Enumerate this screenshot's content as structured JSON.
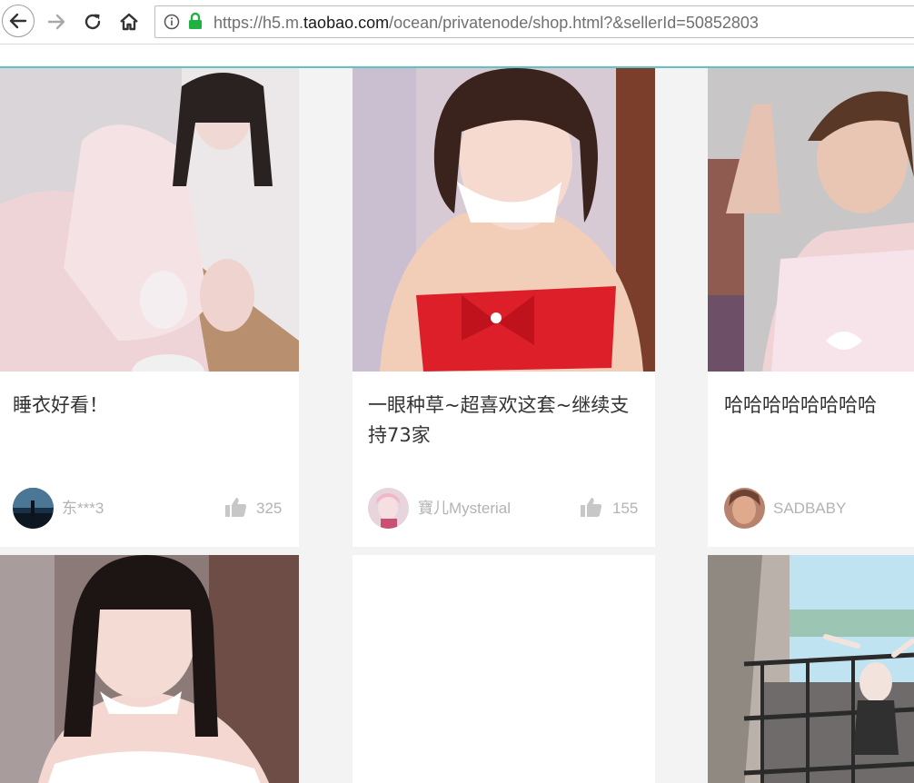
{
  "browser": {
    "url_prefix": "https://h5.m.",
    "url_domain": "taobao.com",
    "url_suffix": "/ocean/privatenode/shop.html?&sellerId=50852803"
  },
  "colors": {
    "accent": "#60c2c3",
    "lock_green": "#1fb141",
    "muted_text": "#b3b3b3",
    "title_text": "#333333"
  },
  "cards": [
    {
      "title": "睡衣好看！",
      "user": "东***3",
      "likes": "325"
    },
    {
      "title": "一眼种草~超喜欢这套~继续支持73家",
      "user": "寶儿Mysterial",
      "likes": "155"
    },
    {
      "title": "哈哈哈哈哈哈哈哈",
      "user": "SADBABY",
      "likes": ""
    }
  ],
  "icons": {
    "back": "arrow-left-icon",
    "forward": "arrow-right-icon",
    "reload": "reload-icon",
    "home": "home-icon",
    "info": "info-icon",
    "lock": "lock-icon",
    "like": "thumbs-up-icon"
  }
}
